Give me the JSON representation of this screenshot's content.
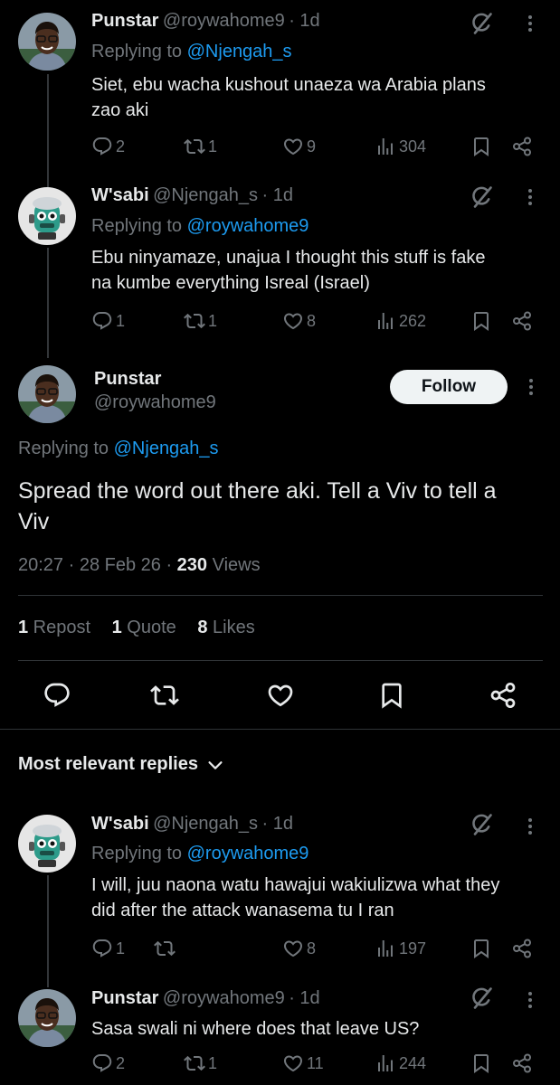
{
  "reply1": {
    "name": "Punstar",
    "handle": "@roywahome9",
    "time": "· 1d",
    "replying_prefix": "Replying to ",
    "replying_to": "@Njengah_s",
    "line1": "Siet, ebu wacha kushout unaeza wa Arabia plans",
    "line2": "zao aki",
    "replies": "2",
    "reposts": "1",
    "likes": "9",
    "views": "304"
  },
  "reply2": {
    "name": "W'sabi",
    "handle": "@Njengah_s",
    "time": "· 1d",
    "replying_prefix": "Replying to ",
    "replying_to": "@roywahome9",
    "line1": "Ebu ninyamaze, unajua I thought this stuff is fake",
    "line2": "na kumbe everything Isreal (Israel)",
    "replies": "1",
    "reposts": "1",
    "likes": "8",
    "views": "262"
  },
  "main": {
    "name": "Punstar",
    "handle": "@roywahome9",
    "follow_label": "Follow",
    "replying_prefix": "Replying to ",
    "replying_to": "@Njengah_s",
    "line1": "Spread the word out there aki. Tell a Viv to tell a",
    "line2": "Viv",
    "time": "20:27 · 28 Feb 26 · ",
    "views_count": "230",
    "views_label": " Views",
    "repost_count": "1",
    "repost_label": " Repost",
    "quote_count": "1",
    "quote_label": " Quote",
    "likes_count": "8",
    "likes_label": " Likes"
  },
  "sort_label": "Most relevant replies",
  "reply3": {
    "name": "W'sabi",
    "handle": "@Njengah_s",
    "time": "· 1d",
    "replying_prefix": "Replying to ",
    "replying_to": "@roywahome9",
    "line1": "I will, juu naona watu hawajui wakiulizwa what they",
    "line2": "did after the attack wanasema tu I ran",
    "replies": "1",
    "reposts": "",
    "likes": "8",
    "views": "197"
  },
  "reply4": {
    "name": "Punstar",
    "handle": "@roywahome9",
    "time": "· 1d",
    "line1": "Sasa swali ni where does that leave US?",
    "replies": "2",
    "reposts": "1",
    "likes": "11",
    "views": "244"
  },
  "colors": {
    "background": "#000000",
    "text": "#e7e9ea",
    "muted": "#71767b",
    "link": "#1d9bf0",
    "follow_bg": "#eff3f4"
  }
}
